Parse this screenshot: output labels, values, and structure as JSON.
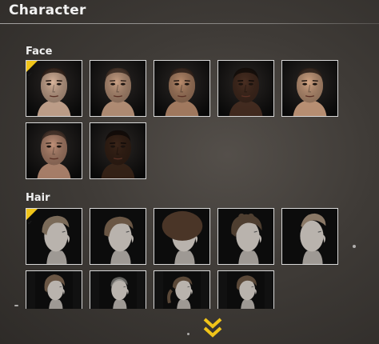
{
  "header": {
    "title": "Character"
  },
  "face": {
    "label": "Face",
    "items": [
      {
        "name": "face-1",
        "selected": true,
        "skin": "#d9b59c",
        "hair": "#2a1d16"
      },
      {
        "name": "face-2",
        "selected": false,
        "skin": "#c9a084",
        "hair": "#3b2b22"
      },
      {
        "name": "face-3",
        "selected": false,
        "skin": "#b98b6c",
        "hair": "#2c1f18"
      },
      {
        "name": "face-4",
        "selected": false,
        "skin": "#4a2f22",
        "hair": "#120c09"
      },
      {
        "name": "face-5",
        "selected": false,
        "skin": "#d3a584",
        "hair": "#2b1f18"
      },
      {
        "name": "face-6",
        "selected": false,
        "skin": "#c09078",
        "hair": "#3a2a22"
      },
      {
        "name": "face-7",
        "selected": false,
        "skin": "#3a2418",
        "hair": "#0f0a08"
      }
    ]
  },
  "hair": {
    "label": "Hair",
    "items": [
      {
        "name": "hair-1",
        "selected": true,
        "style": "undercut",
        "hair": "#7a6a58"
      },
      {
        "name": "hair-2",
        "selected": false,
        "style": "swept",
        "hair": "#6a5644"
      },
      {
        "name": "hair-3",
        "selected": false,
        "style": "afro",
        "hair": "#4a3527"
      },
      {
        "name": "hair-4",
        "selected": false,
        "style": "curly",
        "hair": "#4e3e30"
      },
      {
        "name": "hair-5",
        "selected": false,
        "style": "mohawk",
        "hair": "#8a7866"
      },
      {
        "name": "hair-6",
        "selected": false,
        "style": "curly-top",
        "hair": "#6a5644"
      },
      {
        "name": "hair-7",
        "selected": false,
        "style": "buzz",
        "hair": "#8c8a86"
      },
      {
        "name": "hair-8",
        "selected": false,
        "style": "ponytail",
        "hair": "#5a4838"
      },
      {
        "name": "hair-9",
        "selected": false,
        "style": "wavy",
        "hair": "#5a4838"
      }
    ]
  },
  "footer": {
    "scroll_icon": "double-chevron-down-icon"
  },
  "colors": {
    "accent": "#f0c419",
    "tile_border": "#d8d8d8"
  }
}
